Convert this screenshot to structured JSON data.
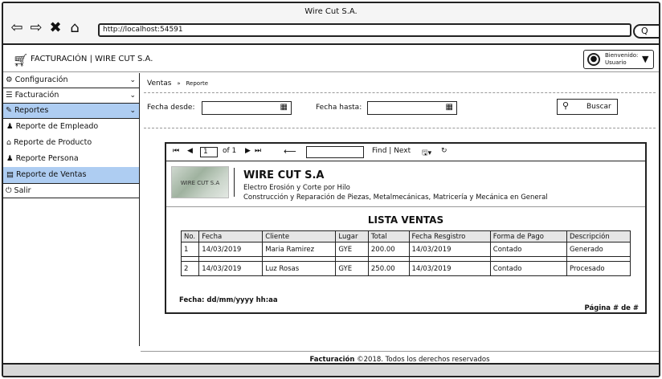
{
  "window": {
    "title": "Wire Cut S.A."
  },
  "browser": {
    "url": "http://localhost:54591",
    "icons": [
      "back-arrow-icon",
      "forward-arrow-icon",
      "close-icon",
      "home-icon",
      "search-icon"
    ]
  },
  "app": {
    "title": "FACTURACIÓN  |  WIRE CUT S.A.",
    "user_line1": "Bienvenido:",
    "user_line2": "Usuario"
  },
  "sidebar": {
    "items": [
      {
        "label": "Configuración",
        "icon": "gears-icon"
      },
      {
        "label": "Facturación",
        "icon": "list-icon"
      },
      {
        "label": "Reportes",
        "icon": "edit-icon"
      }
    ],
    "sub_items": [
      {
        "label": "Reporte de Empleado",
        "icon": "user-icon"
      },
      {
        "label": "Reporte de Producto",
        "icon": "warehouse-icon"
      },
      {
        "label": "Reporte Persona",
        "icon": "users-icon"
      },
      {
        "label": "Reporte de Ventas",
        "icon": "report-icon"
      }
    ],
    "exit": {
      "label": "Salir",
      "icon": "power-icon"
    }
  },
  "breadcrumb": {
    "root": "Ventas",
    "separator": "»",
    "current": "Reporte"
  },
  "filters": {
    "from_label": "Fecha desde:",
    "to_label": "Fecha hasta:",
    "search_label": "Buscar"
  },
  "report": {
    "toolbar": {
      "page_value": "1",
      "page_of": "of 1",
      "find_label": "Find | Next"
    },
    "logo_text": "WIRE CUT S.A",
    "company_name": "WIRE CUT S.A",
    "company_line1": "Electro Erosión y Corte por Hilo",
    "company_line2": "Construcción y Reparación de Piezas, Metalmecánicas, Matricería y Mecánica en General",
    "list_title": "LISTA VENTAS",
    "columns": [
      "No.",
      "Fecha",
      "Cliente",
      "Lugar",
      "Total",
      "Fecha Resgistro",
      "Forma de Pago",
      "Descripción"
    ],
    "rows": [
      [
        "1",
        "14/03/2019",
        "Maria Ramirez",
        "GYE",
        "200.00",
        "14/03/2019",
        "Contado",
        "Generado"
      ],
      [
        "2",
        "14/03/2019",
        "Luz Rosas",
        "GYE",
        "250.00",
        "14/03/2019",
        "Contado",
        "Procesado"
      ]
    ],
    "date_footer": "Fecha: dd/mm/yyyy hh:aa",
    "page_footer": "Página # de #"
  },
  "footer": {
    "bold": "Facturación",
    "rest": " ©2018. Todos los derechos reservados"
  }
}
